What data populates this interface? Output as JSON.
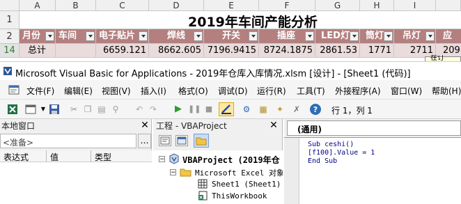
{
  "excel": {
    "columns": [
      "A",
      "B",
      "C",
      "D",
      "E",
      "F",
      "G",
      "H",
      "I"
    ],
    "title": "2019年车间产能分析",
    "row_numbers": [
      "1",
      "2",
      "14"
    ],
    "headers": [
      "月份",
      "车间",
      "电子贴片",
      "焊线",
      "开关",
      "插座",
      "LED灯",
      "筒灯",
      "吊灯",
      "应"
    ],
    "total_row": [
      "总计",
      "",
      "6659.121",
      "8662.605",
      "7196.9415",
      "8724.1875",
      "2861.53",
      "1771",
      "2711",
      "209"
    ],
    "overflow_text": "在订"
  },
  "vba": {
    "window_title": "Microsoft Visual Basic for Applications - 2019年仓库入库情况.xlsm [设计] - [Sheet1 (代码)]",
    "menu": [
      "文件(F)",
      "编辑(E)",
      "视图(V)",
      "插入(I)",
      "格式(O)",
      "调试(D)",
      "运行(R)",
      "工具(T)",
      "外接程序(A)",
      "窗口(W)",
      "帮助(H)"
    ],
    "cursor_position": "行 1，列 1",
    "locals": {
      "title": "本地窗口",
      "status": "<准备>",
      "columns": [
        "表达式",
        "值",
        "类型"
      ]
    },
    "project": {
      "title": "工程 - VBAProject",
      "tree": [
        "VBAProject (2019年仓",
        "Microsoft Excel 对象",
        "Sheet1 (Sheet1)",
        "ThisWorkbook"
      ]
    },
    "code": {
      "object_dropdown": "(通用)",
      "lines": [
        "Sub ceshi()",
        "[f100].Value = 1",
        "End Sub"
      ]
    }
  }
}
